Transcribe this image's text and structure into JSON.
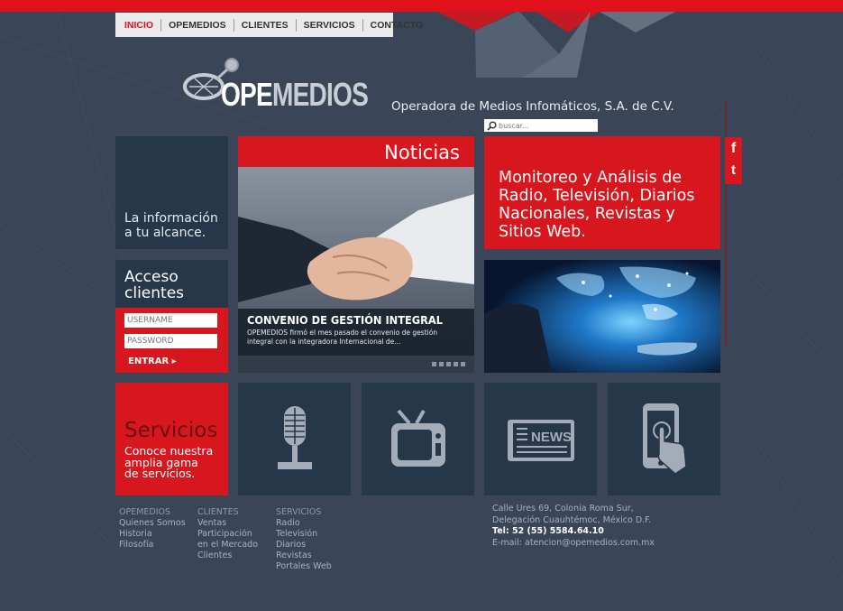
{
  "nav": {
    "items": [
      "INICIO",
      "OPEMEDIOS",
      "CLIENTES",
      "SERVICIOS",
      "CONTACTO"
    ],
    "active_index": 0
  },
  "brand": {
    "logo_text_bold": "OPE",
    "logo_text_light": "MEDIOS",
    "tagline": "Operadora de Medios Infomáticos, S.A. de C.V."
  },
  "search": {
    "placeholder": "buscar..."
  },
  "info_tile": {
    "text": "La información\na tu alcance."
  },
  "access": {
    "title": "Acceso\nclientes",
    "username_placeholder": "USERNAME",
    "password_placeholder": "PASSWORD",
    "enter_label": "ENTRAR ▸"
  },
  "news": {
    "header": "Noticias",
    "headline": "CONVENIO DE GESTIÓN INTEGRAL",
    "summary": "OPEMEDIOS firmó el mes pasado el convenio de gestión integral con la integradora Internacional de...",
    "slide_count": 5
  },
  "monitoring": {
    "text": "Monitoreo y Análisis de Radio, Televisión, Diarios Nacionales, Revistas y Sitios Web."
  },
  "services_tile": {
    "title": "Servicios",
    "text": "Conoce nuestra\namplia gama\nde servicios."
  },
  "service_icons": [
    "microphone-icon",
    "tv-icon",
    "newspaper-icon",
    "tablet-touch-icon"
  ],
  "social": {
    "facebook": "f",
    "twitter": "t"
  },
  "footer": {
    "columns": [
      {
        "heading": "OPEMEDIOS",
        "links": [
          "Quienes Somos",
          "Historia",
          "Filosofía"
        ]
      },
      {
        "heading": "CLIENTES",
        "links": [
          "Ventas",
          "Participación",
          "en el Mercado",
          "Clientes"
        ]
      },
      {
        "heading": "SERVICIOS",
        "links": [
          "Radio",
          "Televisión",
          "Diarios",
          "Revistas",
          "Portales Web"
        ]
      }
    ],
    "address_line1": "Calle Ures 69, Colonia Roma Sur,",
    "address_line2": "Delegación Cuauhtémoc, México D.F.",
    "phone": "Tel: 52 (55) 5584.64.10",
    "email": "E-mail: atencion@opemedios.com.mx"
  },
  "colors": {
    "background": "#3a4658",
    "accent_red": "#d7161e",
    "tile_dark": "#27374a"
  }
}
